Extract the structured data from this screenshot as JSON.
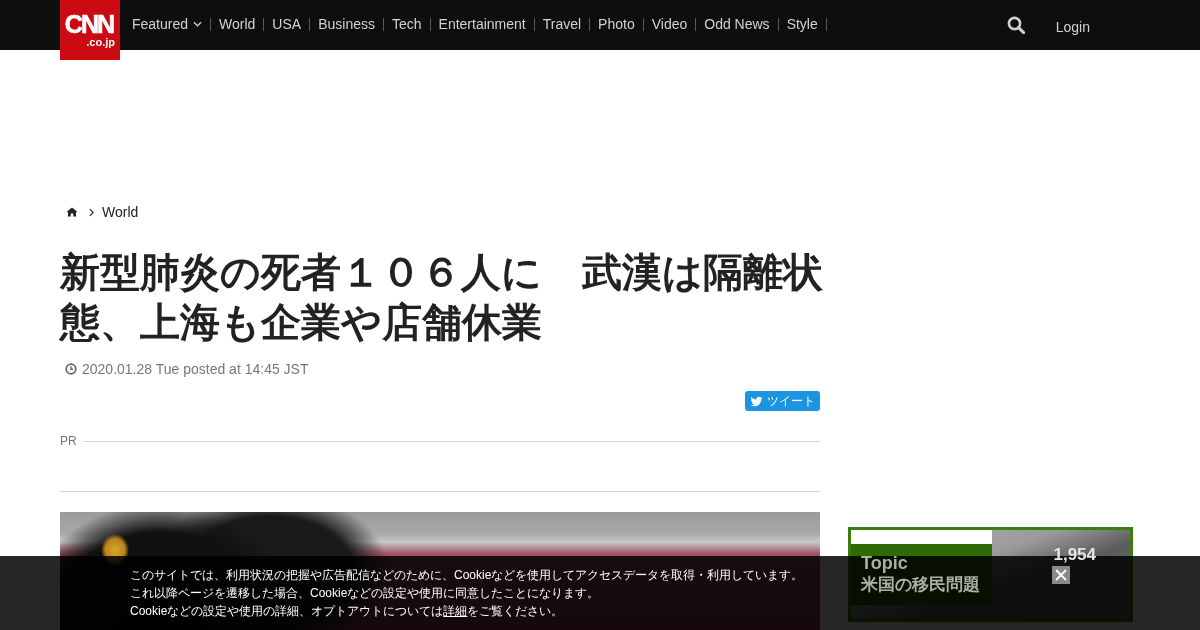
{
  "header": {
    "logo": {
      "main": "CNN",
      "sub": ".co.jp"
    },
    "nav": [
      {
        "label": "Featured",
        "kind": "menu"
      },
      {
        "label": "World",
        "kind": "link"
      },
      {
        "label": "USA",
        "kind": "link"
      },
      {
        "label": "Business",
        "kind": "link"
      },
      {
        "label": "Tech",
        "kind": "link"
      },
      {
        "label": "Entertainment",
        "kind": "link"
      },
      {
        "label": "Travel",
        "kind": "link"
      },
      {
        "label": "Photo",
        "kind": "link"
      },
      {
        "label": "Video",
        "kind": "link"
      },
      {
        "label": "Odd News",
        "kind": "link"
      },
      {
        "label": "Style",
        "kind": "link"
      }
    ],
    "login": "Login"
  },
  "breadcrumb": {
    "items": [
      "World"
    ]
  },
  "article": {
    "title": "新型肺炎の死者１０６人に　武漢は隔離状態、上海も企業や店舗休業",
    "date": "2020.01.28 Tue posted at 14:45 JST",
    "tweet_button": "ツイート",
    "pr_label": "PR"
  },
  "sidebar": {
    "topic_banner": {
      "tag": "Topic",
      "title": "米国の移民問題",
      "count": "1,954"
    }
  },
  "cookie_notice": {
    "lines": [
      "このサイトでは、利用状況の把握や広告配信などのために、Cookieなどを使用してアクセスデータを取得・利用しています。",
      "これ以降ページを遷移した場合、Cookieなどの設定や使用に同意したことになります。"
    ],
    "closing": {
      "before": "Cookieなどの設定や使用の詳細、オプトアウトについては",
      "link": "詳細",
      "after": "をご覧ください。"
    }
  }
}
